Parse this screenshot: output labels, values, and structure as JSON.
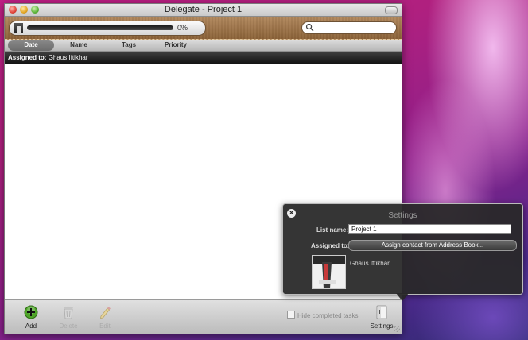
{
  "window": {
    "title": "Delegate - Project 1"
  },
  "header": {
    "progress_percent": 0,
    "progress_label": "0%",
    "search_placeholder": ""
  },
  "columns": [
    "Date",
    "Name",
    "Tags",
    "Priority"
  ],
  "assigned_bar": {
    "label": "Assigned to:",
    "name": "Ghaus Iftikhar"
  },
  "toolbar": {
    "add_label": "Add",
    "delete_label": "Delete",
    "edit_label": "Edit",
    "hide_completed_label": "Hide completed tasks",
    "settings_label": "Settings"
  },
  "settings_panel": {
    "title": "Settings",
    "list_name_label": "List name:",
    "list_name_value": "Project 1",
    "assigned_to_label": "Assigned to:",
    "assign_button_label": "Assign contact from Address Book...",
    "contact_name": "Ghaus Iftikhar"
  },
  "colors": {
    "leather": "#9a6f45",
    "popover": "#282828",
    "add_green": "#3f9a1c"
  }
}
